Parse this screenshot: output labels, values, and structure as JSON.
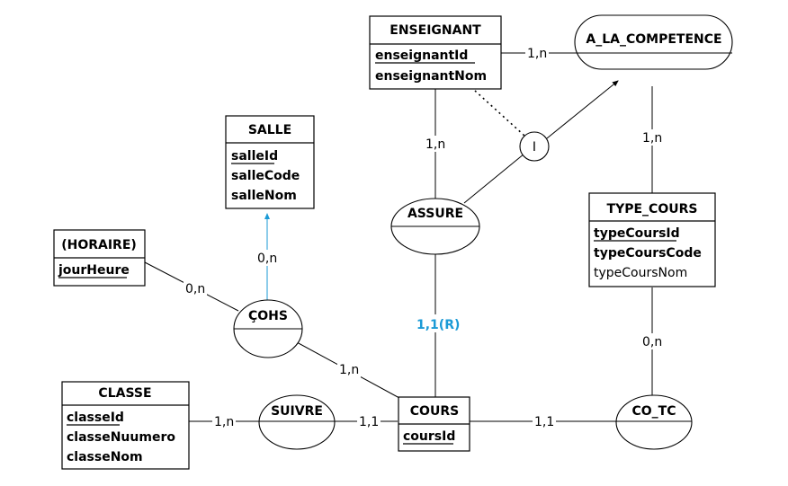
{
  "diagram": {
    "type": "MCD entity-relationship diagram",
    "entities": [
      {
        "id": "enseignant",
        "title": "ENSEIGNANT",
        "attributes": [
          {
            "name": "enseignantId",
            "key": true,
            "bold": true
          },
          {
            "name": "enseignantNom",
            "key": false,
            "bold": true
          }
        ]
      },
      {
        "id": "salle",
        "title": "SALLE",
        "attributes": [
          {
            "name": "salleId",
            "key": true,
            "bold": true
          },
          {
            "name": "salleCode",
            "key": false,
            "bold": true
          },
          {
            "name": "salleNom",
            "key": false,
            "bold": true
          }
        ]
      },
      {
        "id": "horaire",
        "title": "(HORAIRE)",
        "attributes": [
          {
            "name": "jourHeure",
            "key": true,
            "bold": true
          }
        ]
      },
      {
        "id": "type_cours",
        "title": "TYPE_COURS",
        "attributes": [
          {
            "name": "typeCoursId",
            "key": true,
            "bold": true
          },
          {
            "name": "typeCoursCode",
            "key": false,
            "bold": true
          },
          {
            "name": "typeCoursNom",
            "key": false,
            "bold": false
          }
        ]
      },
      {
        "id": "classe",
        "title": "CLASSE",
        "attributes": [
          {
            "name": "classeId",
            "key": true,
            "bold": true
          },
          {
            "name": "classeNuumero",
            "key": false,
            "bold": true
          },
          {
            "name": "classeNom",
            "key": false,
            "bold": true
          }
        ]
      },
      {
        "id": "cours",
        "title": "COURS",
        "attributes": [
          {
            "name": "coursId",
            "key": true,
            "bold": true
          }
        ]
      }
    ],
    "relations": [
      {
        "id": "a_la_competence",
        "title": "A_LA_COMPETENCE"
      },
      {
        "id": "assure",
        "title": "ASSURE"
      },
      {
        "id": "cohs",
        "title": "ÇOHS"
      },
      {
        "id": "suivre",
        "title": "SUIVRE"
      },
      {
        "id": "co_tc",
        "title": "CO_TC"
      }
    ],
    "constraint": {
      "id": "inclusion",
      "symbol": "I"
    },
    "links": [
      {
        "from": "enseignant",
        "to": "a_la_competence",
        "cardinality": "1,n",
        "color": "#000000"
      },
      {
        "from": "a_la_competence",
        "to": "type_cours",
        "cardinality": "1,n",
        "color": "#000000"
      },
      {
        "from": "enseignant",
        "to": "assure",
        "cardinality": "1,n",
        "color": "#000000"
      },
      {
        "from": "assure",
        "to": "cours",
        "cardinality": "1,1(R)",
        "color": "#1a9ad6"
      },
      {
        "from": "cohs",
        "to": "salle",
        "cardinality": "0,n",
        "color": "#1a9ad6",
        "arrow": true
      },
      {
        "from": "horaire",
        "to": "cohs",
        "cardinality": "0,n",
        "color": "#000000"
      },
      {
        "from": "cohs",
        "to": "cours",
        "cardinality": "1,n",
        "color": "#000000"
      },
      {
        "from": "classe",
        "to": "suivre",
        "cardinality": "1,n",
        "color": "#000000"
      },
      {
        "from": "suivre",
        "to": "cours",
        "cardinality": "1,1",
        "color": "#000000"
      },
      {
        "from": "cours",
        "to": "co_tc",
        "cardinality": "1,1",
        "color": "#000000"
      },
      {
        "from": "co_tc",
        "to": "type_cours",
        "cardinality": "0,n",
        "color": "#000000"
      },
      {
        "from": "enseignant",
        "to": "inclusion",
        "cardinality": "",
        "style": "dotted"
      },
      {
        "from": "assure",
        "to": "inclusion",
        "cardinality": ""
      },
      {
        "from": "inclusion",
        "to": "a_la_competence",
        "cardinality": "",
        "arrow": true
      }
    ]
  }
}
